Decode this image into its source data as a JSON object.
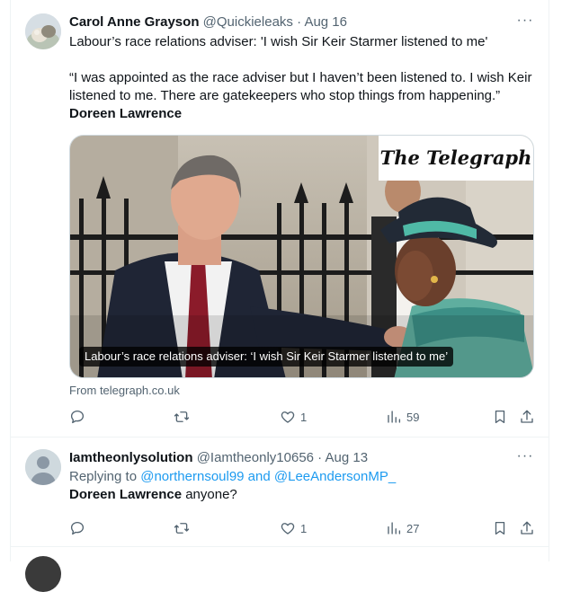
{
  "tweets": [
    {
      "author": {
        "name": "Carol Anne Grayson",
        "handle": "@Quickieleaks"
      },
      "separator": " · ",
      "date": "Aug 16",
      "more": "···",
      "headline": "Labour’s race relations adviser: 'I wish Sir Keir Starmer listened to me'",
      "quote": "“I was appointed as the race adviser but I haven’t been listened to. I wish Keir listened to me. There are gatekeepers who stop things from happening.”",
      "quote_author": "Doreen Lawrence",
      "card": {
        "brand": "The Telegraph",
        "caption": "Labour’s race relations adviser: ‘I wish Sir Keir Starmer listened to me’",
        "source": "From telegraph.co.uk"
      },
      "stats": {
        "replies": "",
        "retweets": "",
        "likes": "1",
        "views": "59"
      }
    },
    {
      "author": {
        "name": "Iamtheonlysolution",
        "handle": "@Iamtheonly10656"
      },
      "separator": " · ",
      "date": "Aug 13",
      "more": "···",
      "replying_prefix": "Replying to ",
      "replying_to": "@northernsoul99 and @LeeAndersonMP_",
      "mention_bold": "Doreen Lawrence",
      "text_rest": " anyone?",
      "stats": {
        "replies": "",
        "retweets": "",
        "likes": "1",
        "views": "27"
      }
    }
  ],
  "icons": [
    "reply-icon",
    "retweet-icon",
    "like-icon",
    "views-icon",
    "bookmark-icon",
    "share-icon",
    "more-icon",
    "avatar"
  ],
  "colors": {
    "text": "#0f1419",
    "secondary": "#536471",
    "link": "#1d9bf0",
    "border": "#eff3f4"
  }
}
